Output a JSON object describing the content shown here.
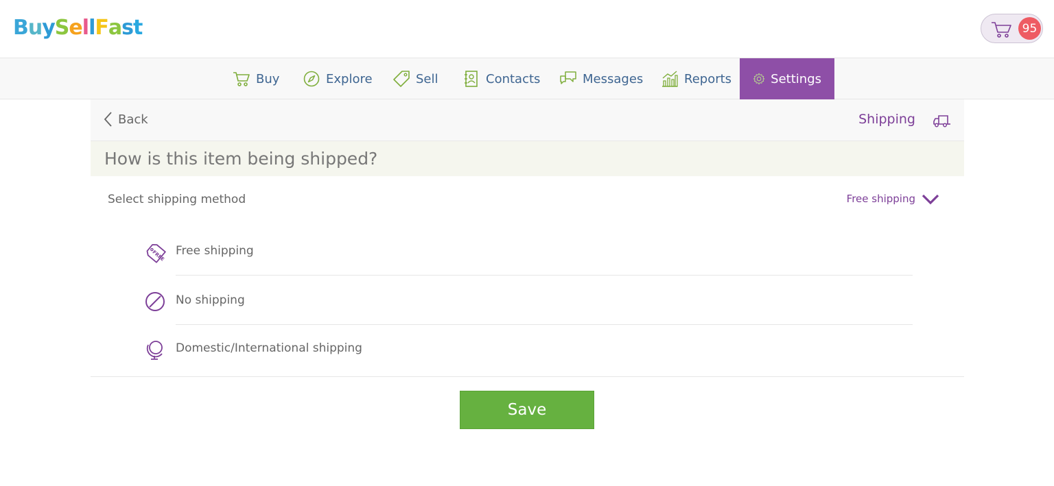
{
  "brand": {
    "letters": [
      {
        "ch": "B",
        "color": "#3aa6d8"
      },
      {
        "ch": "u",
        "color": "#56b6c9"
      },
      {
        "ch": "y",
        "color": "#2e9bd6"
      },
      {
        "ch": "S",
        "color": "#8cc63f"
      },
      {
        "ch": "e",
        "color": "#f6a21e"
      },
      {
        "ch": "l",
        "color": "#e85a8c"
      },
      {
        "ch": "l",
        "color": "#2e9bd6"
      },
      {
        "ch": "F",
        "color": "#f5c518"
      },
      {
        "ch": "a",
        "color": "#8cc63f"
      },
      {
        "ch": "s",
        "color": "#2e9bd6"
      },
      {
        "ch": "t",
        "color": "#29a8e0"
      }
    ]
  },
  "cart": {
    "icon": "cart-icon",
    "count": "95"
  },
  "nav": {
    "items": [
      {
        "label": "Buy",
        "icon": "cart-icon"
      },
      {
        "label": "Explore",
        "icon": "compass-icon"
      },
      {
        "label": "Sell",
        "icon": "tag-icon"
      },
      {
        "label": "Contacts",
        "icon": "address-book-icon"
      },
      {
        "label": "Messages",
        "icon": "chat-bubbles-icon"
      },
      {
        "label": "Reports",
        "icon": "bar-chart-icon"
      },
      {
        "label": "Settings",
        "icon": "gear-icon",
        "active": true
      }
    ]
  },
  "panel": {
    "back_label": "Back",
    "title": "Shipping",
    "question": "How is this item being shipped?",
    "method_label": "Select shipping method",
    "method_value": "Free shipping",
    "options": [
      {
        "label": "Free shipping",
        "icon": "free-tag-icon"
      },
      {
        "label": "No shipping",
        "icon": "prohibited-icon"
      },
      {
        "label": "Domestic/International shipping",
        "icon": "globe-icon"
      }
    ]
  },
  "save_label": "Save",
  "colors": {
    "accent": "#8e4fa7",
    "nav_text": "#3e6591",
    "icon_green": "#7fae3c",
    "save": "#66b140",
    "badge": "#ee5b63"
  }
}
